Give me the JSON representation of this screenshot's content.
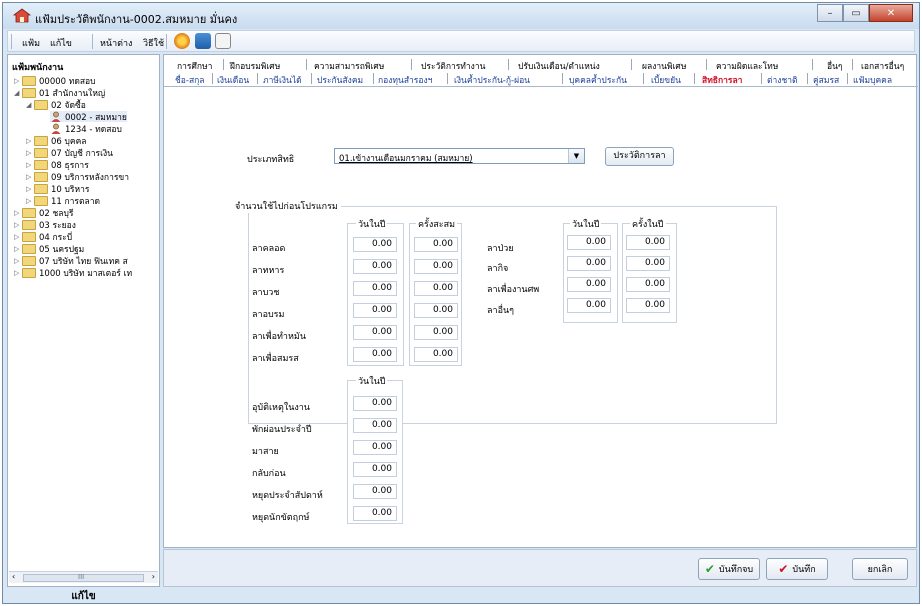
{
  "window": {
    "title": "แฟ้มประวัติพนักงาน-0002.สมหมาย มั่นคง",
    "minimize_glyph": "–",
    "maximize_glyph": "▭",
    "close_glyph": "✕"
  },
  "menubar": {
    "items": [
      "แฟ้ม",
      "แก้ไข",
      "หน้าต่าง",
      "วิธีใช้"
    ]
  },
  "sidebar": {
    "title": "แฟ้มพนักงาน",
    "footer": "แก้ไข",
    "tree": [
      {
        "label": "00000 ทดสอบ"
      },
      {
        "label": "01 สำนักงานใหญ่"
      },
      {
        "label": "02 จัดซื้อ"
      },
      {
        "label": "0002 - สมหมาย"
      },
      {
        "label": "1234 - ทดสอบ"
      },
      {
        "label": "06 บุคคล"
      },
      {
        "label": "07 บัญชี การเงิน"
      },
      {
        "label": "08 ธุรการ"
      },
      {
        "label": "09 บริการหลังการขา"
      },
      {
        "label": "10 บริหาร"
      },
      {
        "label": "11 การตลาด"
      },
      {
        "label": "02 ชลบุรี"
      },
      {
        "label": "03 ระยอง"
      },
      {
        "label": "04 กระบี่"
      },
      {
        "label": "05 นครปฐม"
      },
      {
        "label": "07 บริษัท ไทย ฟินเทค ส"
      },
      {
        "label": "1000 บริษัท มาสเตอร์ เท"
      }
    ],
    "scroll_marker": "III"
  },
  "tabs_row1": [
    "การศึกษา",
    "ฝึกอบรมพิเศษ",
    "ความสามารถพิเศษ",
    "ประวัติการทำงาน",
    "ปรับเงินเดือน/ตำแหน่ง",
    "ผลงานพิเศษ",
    "ความผิดและโทษ",
    "อื่นๆ",
    "เอกสารอื่นๆ"
  ],
  "tabs_row2": [
    "ชื่อ-สกุล",
    "เงินเดือน",
    "ภาษีเงินได้",
    "ประกันสังคม",
    "กองทุนสำรองฯ",
    "เงินค้ำประกัน-กู้-ผ่อน",
    "บุคคลค้ำประกัน",
    "เบี้ยขยัน",
    "สิทธิการลา",
    "ต่างชาติ",
    "คู่สมรส",
    "แฟ้มบุคคล"
  ],
  "active_tab": "สิทธิการลา",
  "form": {
    "leave_type_label": "ประเภทสิทธิ",
    "leave_type_value": "01.เข้างานเดือนมกราคม (สมหมาย)",
    "history_button": "ประวัติการลา",
    "group_title": "จำนวนใช้ไปก่อนโปรแกรม",
    "col_days_per_year": "วันในปี",
    "col_times_accum": "ครั้งสะสม",
    "col_times_per_year": "ครั้งในปี",
    "left_rows": [
      {
        "label": "ลาคลอด",
        "days": "0.00",
        "times": "0.00"
      },
      {
        "label": "ลาทหาร",
        "days": "0.00",
        "times": "0.00"
      },
      {
        "label": "ลาบวช",
        "days": "0.00",
        "times": "0.00"
      },
      {
        "label": "ลาอบรม",
        "days": "0.00",
        "times": "0.00"
      },
      {
        "label": "ลาเพื่อทำหมัน",
        "days": "0.00",
        "times": "0.00"
      },
      {
        "label": "ลาเพื่อสมรส",
        "days": "0.00",
        "times": "0.00"
      }
    ],
    "right_rows": [
      {
        "label": "ลาป่วย",
        "days": "0.00",
        "times": "0.00"
      },
      {
        "label": "ลากิจ",
        "days": "0.00",
        "times": "0.00"
      },
      {
        "label": "ลาเพื่องานศพ",
        "days": "0.00",
        "times": "0.00"
      },
      {
        "label": "ลาอื่นๆ",
        "days": "0.00",
        "times": "0.00"
      }
    ],
    "lower_rows": [
      {
        "label": "อุบัติเหตุในงาน",
        "days": "0.00"
      },
      {
        "label": "พักผ่อนประจำปี",
        "days": "0.00"
      },
      {
        "label": "มาสาย",
        "days": "0.00"
      },
      {
        "label": "กลับก่อน",
        "days": "0.00"
      },
      {
        "label": "หยุดประจำสัปดาห์",
        "days": "0.00"
      },
      {
        "label": "หยุดนักขัตฤกษ์",
        "days": "0.00"
      }
    ]
  },
  "footer_buttons": {
    "save_close": "บันทึกจบ",
    "save": "บันทึก",
    "cancel": "ยกเลิก"
  },
  "colors": {
    "active_tab": "#d0102a",
    "link_tab": "#1a3f99",
    "window_bg": "#d9e6f3"
  }
}
